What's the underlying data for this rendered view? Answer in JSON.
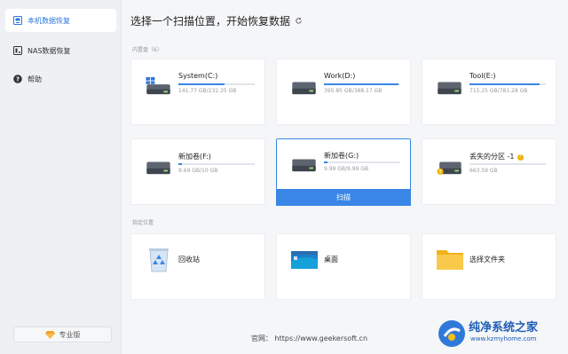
{
  "sidebar": {
    "items": [
      {
        "label": "本机数据恢复",
        "icon": "computer-icon",
        "active": true
      },
      {
        "label": "NAS数据恢复",
        "icon": "nas-icon",
        "active": false
      },
      {
        "label": "帮助",
        "icon": "help-icon",
        "active": false
      }
    ],
    "edition_label": "专业版"
  },
  "main": {
    "title": "选择一个扫描位置，开始恢复数据",
    "internal_label": "内置盘（6）",
    "drives": [
      {
        "name": "System(C:)",
        "size": "141.77 GB/232.35 GB",
        "usage": 0.61,
        "icon": "windows-drive-icon"
      },
      {
        "name": "Work(D:)",
        "size": "395.85 GB/388.17 GB",
        "usage": 0.98,
        "icon": "drive-icon"
      },
      {
        "name": "Tool(E:)",
        "size": "715.25 GB/781.28 GB",
        "usage": 0.92,
        "icon": "drive-icon"
      },
      {
        "name": "新加卷(F:)",
        "size": "9.69 GB/10 GB",
        "usage": 0.05,
        "icon": "drive-icon"
      },
      {
        "name": "新加卷(G:)",
        "size": "9.99 GB/9.99 GB",
        "usage": 0.05,
        "icon": "drive-icon"
      },
      {
        "name": "丢失的分区 -1",
        "size": "663.59 GB",
        "usage": 0.0,
        "icon": "lost-partition-icon"
      }
    ],
    "scan_label": "扫描",
    "locations_label": "指定位置",
    "locations": [
      {
        "label": "回收站",
        "icon": "recycle-bin-icon"
      },
      {
        "label": "桌面",
        "icon": "desktop-icon"
      },
      {
        "label": "选择文件夹",
        "icon": "folder-icon"
      }
    ],
    "footer": "官网：  https://www.geekersoft.cn"
  },
  "watermark": {
    "title": "纯净系统之家",
    "url": "www.kzmyhome.com"
  },
  "colors": {
    "accent": "#3a86e6",
    "sidebar_bg": "#eef0f4",
    "page_bg": "#f5f6f8"
  }
}
